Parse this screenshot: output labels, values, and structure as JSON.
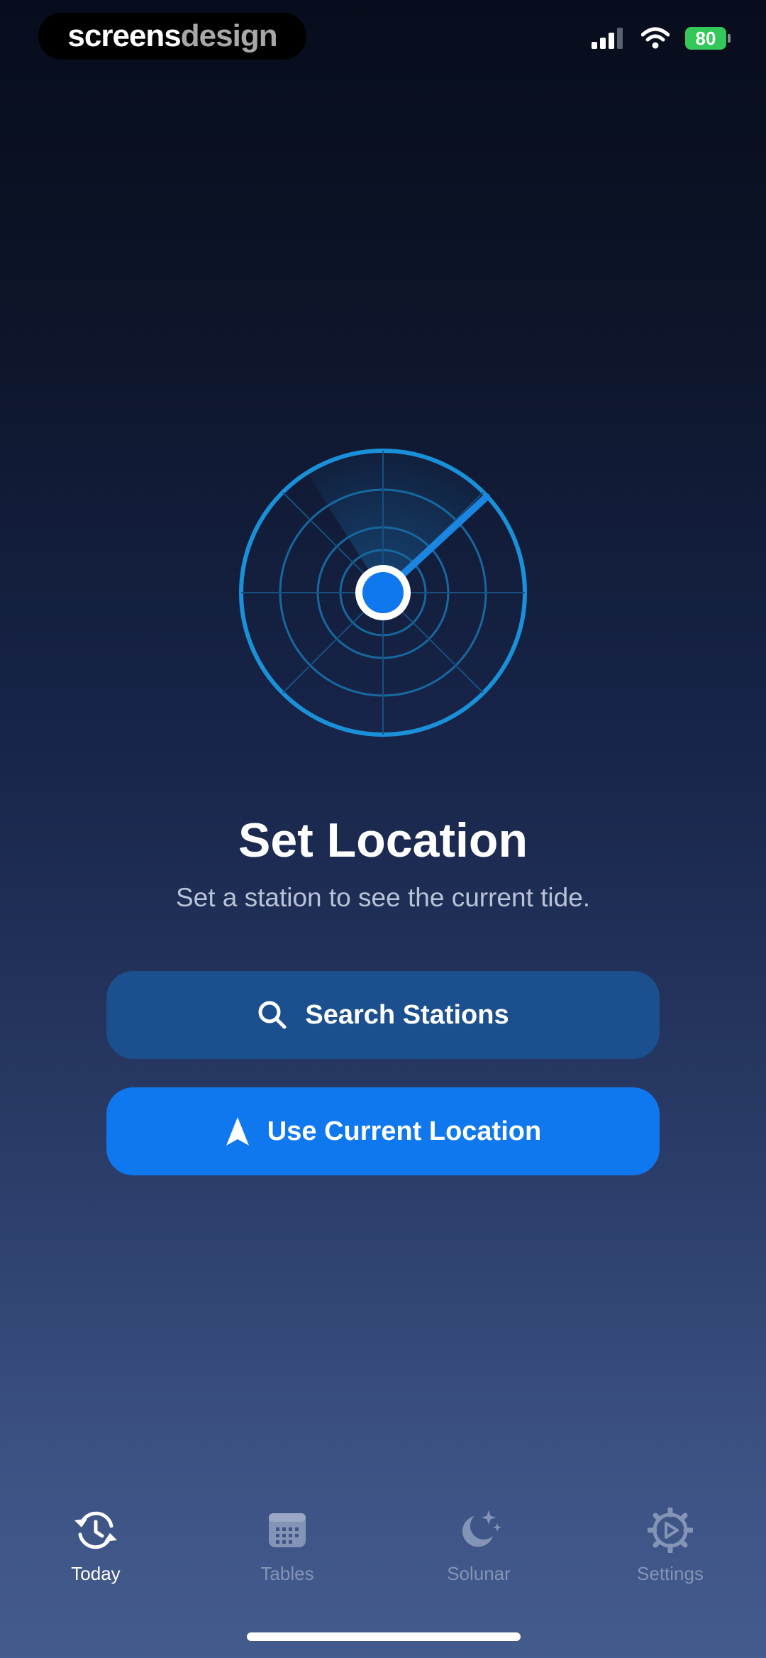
{
  "watermark": {
    "part1": "screens",
    "part2": "design"
  },
  "status_bar": {
    "battery": "80"
  },
  "main": {
    "title": "Set Location",
    "subtitle": "Set a station to see the current tide.",
    "search_button": {
      "label": "Search Stations",
      "icon": "search-icon"
    },
    "location_button": {
      "label": "Use Current Location",
      "icon": "location-arrow-icon"
    }
  },
  "tabs": [
    {
      "label": "Today",
      "icon": "clock-refresh-icon",
      "active": true
    },
    {
      "label": "Tables",
      "icon": "calendar-grid-icon",
      "active": false
    },
    {
      "label": "Solunar",
      "icon": "moon-stars-icon",
      "active": false
    },
    {
      "label": "Settings",
      "icon": "gear-play-icon",
      "active": false
    }
  ],
  "colors": {
    "accent": "#0f78ee",
    "secondary_button": "#1b4f8e",
    "battery": "#34c759",
    "tab_inactive": "#8494b6",
    "radar": "#1a90d8"
  }
}
